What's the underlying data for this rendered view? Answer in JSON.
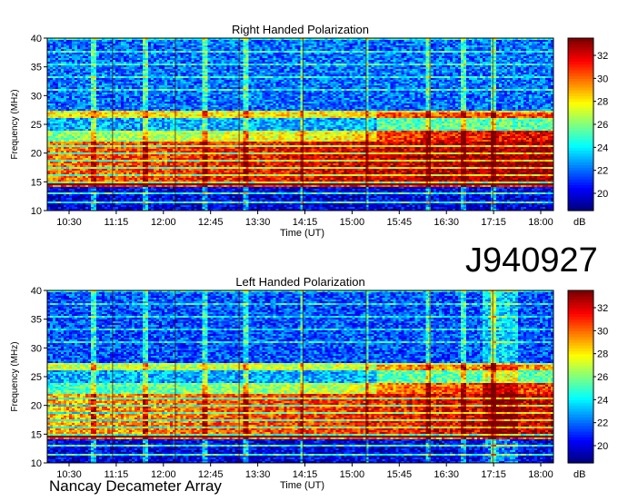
{
  "identifier": "J940927",
  "footer": "Nancay Decameter Array",
  "chart_data": [
    {
      "type": "heatmap",
      "title": "Right Handed Polarization",
      "xlabel": "Time (UT)",
      "ylabel": "Frequency (MHz)",
      "x_ticks": [
        "10:30",
        "11:15",
        "12:00",
        "12:45",
        "13:30",
        "14:15",
        "15:00",
        "15:45",
        "16:30",
        "17:15",
        "18:00"
      ],
      "y_ticks": [
        10,
        15,
        20,
        25,
        30,
        35,
        40
      ],
      "ylim": [
        10,
        40
      ],
      "colorbar": {
        "unit": "dB",
        "ticks": [
          20,
          22,
          24,
          26,
          28,
          30,
          32
        ],
        "range": [
          18.5,
          33.5
        ]
      },
      "intensity_bands_mhz": [
        {
          "freq_range": [
            10,
            14
          ],
          "level_db": 20
        },
        {
          "freq_range": [
            14,
            22
          ],
          "level_db": 31
        },
        {
          "freq_range": [
            22,
            24
          ],
          "level_db": 27
        },
        {
          "freq_range": [
            24,
            26
          ],
          "level_db": 23
        },
        {
          "freq_range": [
            26,
            27.5
          ],
          "level_db": 28
        },
        {
          "freq_range": [
            27.5,
            40
          ],
          "level_db": 22
        }
      ]
    },
    {
      "type": "heatmap",
      "title": "Left Handed Polarization",
      "xlabel": "Time (UT)",
      "ylabel": "Frequency (MHz)",
      "x_ticks": [
        "10:30",
        "11:15",
        "12:00",
        "12:45",
        "13:30",
        "14:15",
        "15:00",
        "15:45",
        "16:30",
        "17:15",
        "18:00"
      ],
      "y_ticks": [
        10,
        15,
        20,
        25,
        30,
        35,
        40
      ],
      "ylim": [
        10,
        40
      ],
      "colorbar": {
        "unit": "dB",
        "ticks": [
          20,
          22,
          24,
          26,
          28,
          30,
          32
        ],
        "range": [
          18.5,
          33.5
        ]
      },
      "intensity_bands_mhz": [
        {
          "freq_range": [
            10,
            14
          ],
          "level_db": 20
        },
        {
          "freq_range": [
            14,
            22
          ],
          "level_db": 30
        },
        {
          "freq_range": [
            22,
            24
          ],
          "level_db": 26
        },
        {
          "freq_range": [
            24,
            26
          ],
          "level_db": 23
        },
        {
          "freq_range": [
            26,
            27.5
          ],
          "level_db": 27
        },
        {
          "freq_range": [
            27.5,
            40
          ],
          "level_db": 21.5
        }
      ]
    }
  ]
}
